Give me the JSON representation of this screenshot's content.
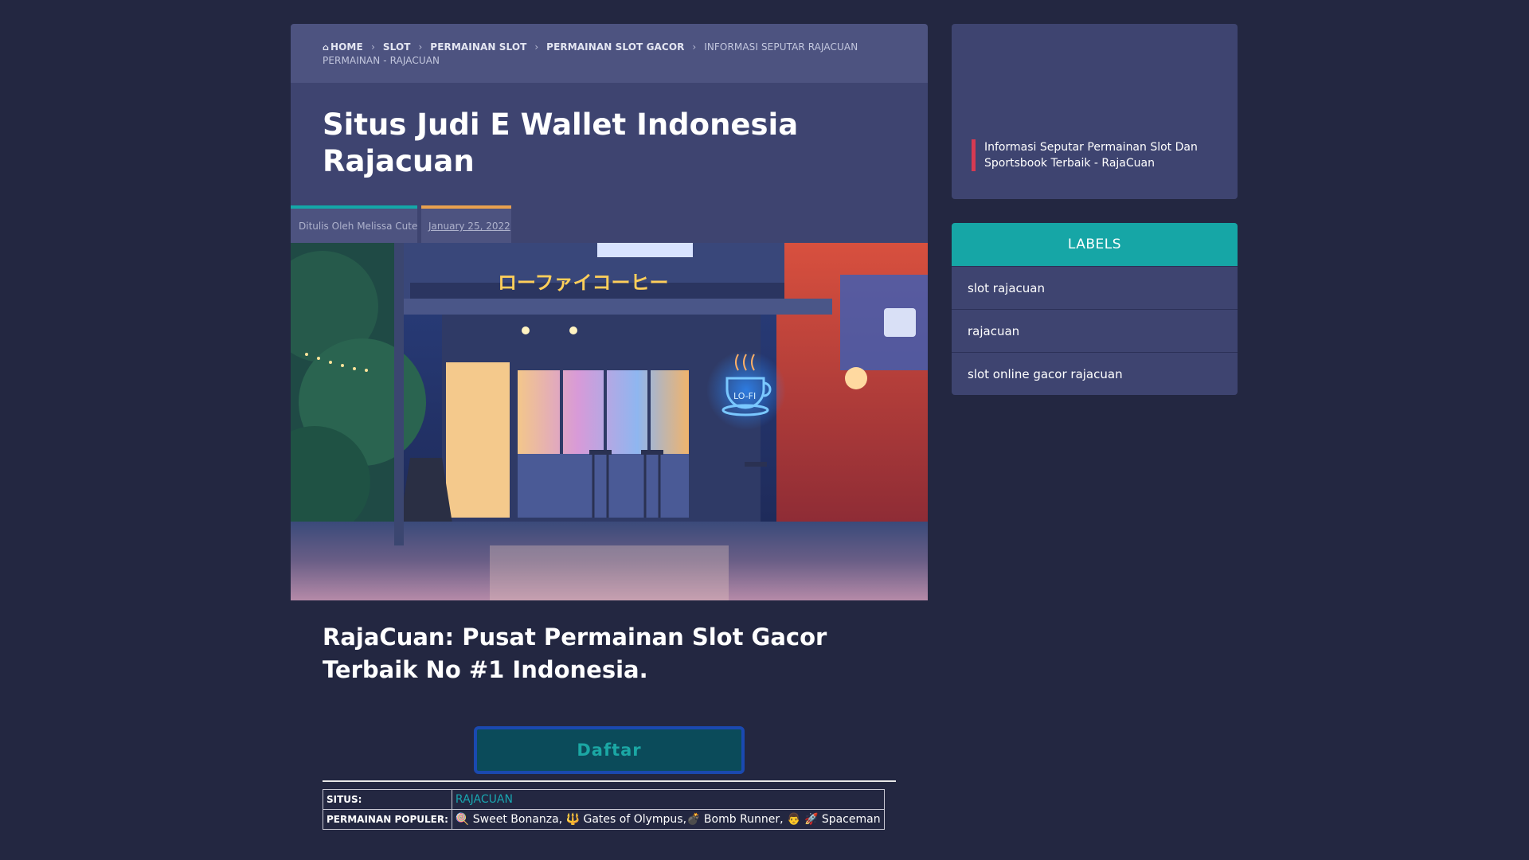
{
  "breadcrumb": {
    "home": "HOME",
    "items": [
      "SLOT",
      "PERMAINAN SLOT",
      "PERMAINAN SLOT GACOR"
    ],
    "current": "INFORMASI SEPUTAR RAJACUAN PERMAINAN - RAJACUAN"
  },
  "post": {
    "title": "Situs Judi E Wallet Indonesia Rajacuan",
    "author": "Ditulis Oleh Melissa Cute",
    "date": "January 25, 2022"
  },
  "hero": {
    "sign_text": "ローファイコーヒー",
    "cup_text": "LO-FI"
  },
  "content": {
    "heading": "RajaCuan: Pusat Permainan Slot Gacor Terbaik No #1 Indonesia.",
    "daftar_label": "Daftar",
    "table": {
      "rows": [
        {
          "key": "SITUS:",
          "value": "RAJACUAN"
        },
        {
          "key": "PERMAINAN POPULER:",
          "value": "🍭 Sweet Bonanza, 🔱 Gates of Olympus,💣 Bomb Runner, 👨 🚀 Spaceman"
        }
      ]
    }
  },
  "sidebar": {
    "popular_post": "Informasi Seputar Permainan Slot Dan Sportsbook Terbaik - RajaCuan",
    "labels_title": "LABELS",
    "labels": [
      "slot rajacuan",
      "rajacuan",
      "slot online gacor rajacuan"
    ]
  },
  "colors": {
    "background": "#232741",
    "panel": "#3e4470",
    "breadcrumb_panel": "#4d5380",
    "accent_teal": "#16a6a6",
    "accent_orange": "#e9a14e",
    "accent_red": "#d73a52",
    "button_border": "#1a49b0"
  }
}
